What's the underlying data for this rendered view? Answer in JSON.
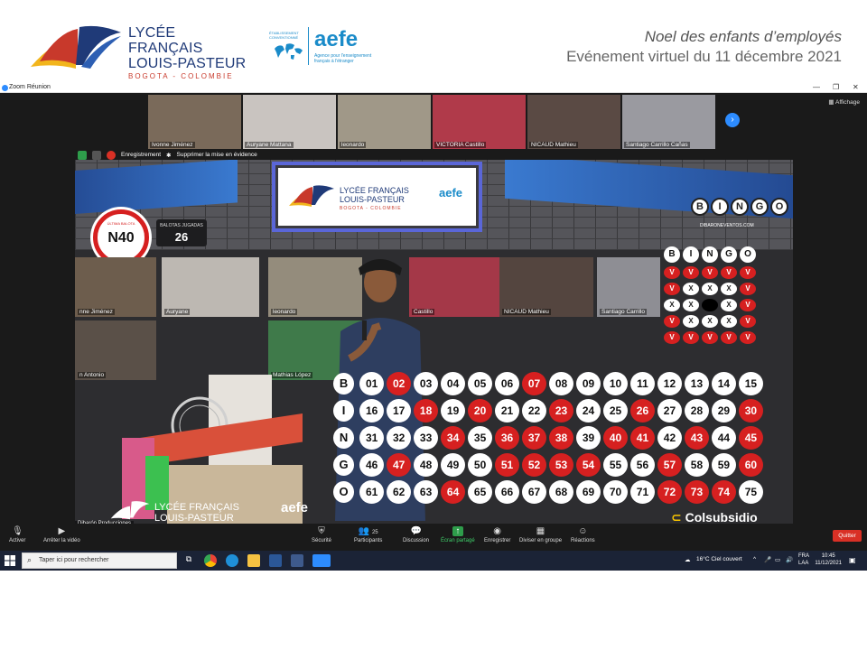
{
  "slide": {
    "lycee_line1": "LYCÉE FRANÇAIS",
    "lycee_line2": "LOUIS-PASTEUR",
    "lycee_line3": "BOGOTA - COLOMBIE",
    "aefe_name": "aefe",
    "aefe_small": "ÉTABLISSEMENT CONVENTIONNÉ",
    "aefe_tagline": "Agence pour l'enseignement français à l'étranger",
    "event_line1": "Noel des enfants d’employés",
    "event_line2": "Evénement virtuel du 11 décembre 2021"
  },
  "zoom": {
    "window_title": "Zoom Réunion",
    "view_label": "Affichage",
    "share_status": {
      "recording": "Enregistrement",
      "remove_highlight": "Supprimer la mise en évidence"
    },
    "participants": [
      {
        "name": "Ivonne Jiménez",
        "bg": "#7a6a5a"
      },
      {
        "name": "Auryane Mattana",
        "bg": "#c9c4c0"
      },
      {
        "name": "leonardo",
        "bg": "#a09888"
      },
      {
        "name": "VICTORIA Castillo",
        "bg": "#b03a4a"
      },
      {
        "name": "NICAUD Mathieu",
        "bg": "#5a4a44"
      },
      {
        "name": "Santiago Carrillo Cañas",
        "bg": "#9a9aa0"
      }
    ],
    "inner_tiles": [
      {
        "name": "nne Jiménez"
      },
      {
        "name": "Auryane"
      },
      {
        "name": "leonardo"
      },
      {
        "name": "Castillo"
      },
      {
        "name": "NICAUD Mathieu"
      },
      {
        "name": "Santiago Carrillo"
      },
      {
        "name": "n Antonio"
      },
      {
        "name": "Mathias López"
      }
    ],
    "toolbar": {
      "mute": "Activer",
      "video": "Arrêter la vidéo",
      "security": "Sécurité",
      "participants": "Participants",
      "participants_count": "25",
      "chat": "Discussion",
      "share": "Écran partagé",
      "record": "Enregistrer",
      "breakout": "Diviser en groupe",
      "reactions": "Réactions",
      "quit": "Quitter"
    },
    "presenter_label": "Dibarón Producciones"
  },
  "bingo": {
    "logo_letters": [
      "B",
      "I",
      "N",
      "G",
      "O"
    ],
    "logo_url": "DIBARONEVENTOS.COM",
    "last_ball_label": "ÚLTIMA BALOTA",
    "last_ball": "N40",
    "played_label": "BALOTAS JUGADAS",
    "played_count": "26",
    "card_header": [
      "B",
      "I",
      "N",
      "G",
      "O"
    ],
    "card": [
      [
        "V",
        "V",
        "V",
        "V",
        "V"
      ],
      [
        "V",
        "X",
        "X",
        "X",
        "V"
      ],
      [
        "X",
        "X",
        "",
        "X",
        "V"
      ],
      [
        "V",
        "X",
        "X",
        "X",
        "V"
      ],
      [
        "V",
        "V",
        "V",
        "V",
        "V"
      ]
    ],
    "board_letters": [
      "B",
      "I",
      "N",
      "G",
      "O"
    ],
    "board": [
      [
        "01",
        "02",
        "03",
        "04",
        "05",
        "06",
        "07",
        "08",
        "09",
        "10",
        "11",
        "12",
        "13",
        "14",
        "15"
      ],
      [
        "16",
        "17",
        "18",
        "19",
        "20",
        "21",
        "22",
        "23",
        "24",
        "25",
        "26",
        "27",
        "28",
        "29",
        "30"
      ],
      [
        "31",
        "32",
        "33",
        "34",
        "35",
        "36",
        "37",
        "38",
        "39",
        "40",
        "41",
        "42",
        "43",
        "44",
        "45"
      ],
      [
        "46",
        "47",
        "48",
        "49",
        "50",
        "51",
        "52",
        "53",
        "54",
        "55",
        "56",
        "57",
        "58",
        "59",
        "60"
      ],
      [
        "61",
        "62",
        "63",
        "64",
        "65",
        "66",
        "67",
        "68",
        "69",
        "70",
        "71",
        "72",
        "73",
        "74",
        "75"
      ]
    ],
    "called": [
      "02",
      "07",
      "18",
      "20",
      "23",
      "26",
      "30",
      "34",
      "36",
      "37",
      "38",
      "40",
      "41",
      "43",
      "45",
      "47",
      "51",
      "52",
      "53",
      "54",
      "57",
      "60",
      "64",
      "72",
      "73",
      "74"
    ],
    "sponsor": "Colsubsidio"
  },
  "taskbar": {
    "search_placeholder": "Taper ici pour rechercher",
    "weather": "16°C  Ciel couvert",
    "lang1": "FRA",
    "lang2": "LAA",
    "time": "10:45",
    "date": "11/12/2021"
  },
  "colors": {
    "called_red": "#d62020",
    "zoom_blue": "#2d8cff",
    "quit_red": "#d93025",
    "lycee_blue": "#1f3a78",
    "aefe_blue": "#1a8bc9"
  }
}
